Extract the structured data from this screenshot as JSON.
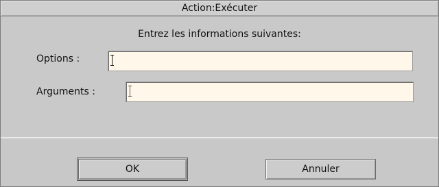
{
  "window": {
    "title": "Action:Exécuter"
  },
  "dialog": {
    "prompt": "Entrez les informations suivantes:",
    "options_label": "Options :",
    "options_value": "",
    "arguments_label": "Arguments :",
    "arguments_value": ""
  },
  "buttons": {
    "ok_label": "OK",
    "cancel_label": "Annuler"
  }
}
